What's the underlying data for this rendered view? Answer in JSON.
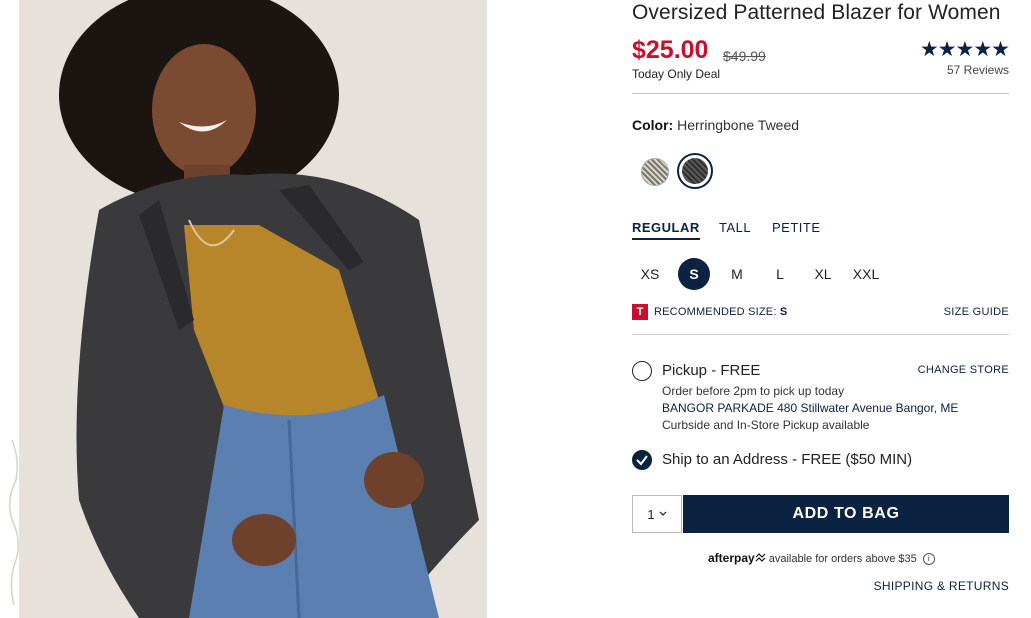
{
  "product": {
    "title": "Oversized Patterned Blazer for Women",
    "price": "$25.00",
    "original_price": "$49.99",
    "deal_text": "Today Only Deal",
    "rating_stars": "★★★★★",
    "reviews": "57 Reviews"
  },
  "color": {
    "label": "Color:",
    "value": "Herringbone Tweed",
    "swatches": [
      "plaid-swatch",
      "herringbone-swatch"
    ]
  },
  "fits": [
    "REGULAR",
    "TALL",
    "PETITE"
  ],
  "sizes": [
    "XS",
    "S",
    "M",
    "L",
    "XL",
    "XXL"
  ],
  "selected_size": "S",
  "recommendation": {
    "icon": "T",
    "label": "RECOMMENDED SIZE:",
    "size": "S",
    "guide": "SIZE GUIDE"
  },
  "fulfillment": {
    "pickup_label": "Pickup - FREE",
    "change_store": "CHANGE STORE",
    "pickup_note": "Order before 2pm to pick up today",
    "store_name": "BANGOR PARKADE 480 Stillwater Avenue  Bangor, ME",
    "pickup_avail": "Curbside and In-Store Pickup available",
    "ship_label": "Ship to an Address - FREE ($50 MIN)"
  },
  "cart": {
    "qty": "1",
    "add_to_bag": "ADD TO BAG"
  },
  "afterpay": {
    "logo": "afterpay",
    "text": "available for orders above $35"
  },
  "shipping_returns": "SHIPPING & RETURNS",
  "colors": {
    "navy": "#0b2240",
    "sale_red": "#c8102e"
  }
}
